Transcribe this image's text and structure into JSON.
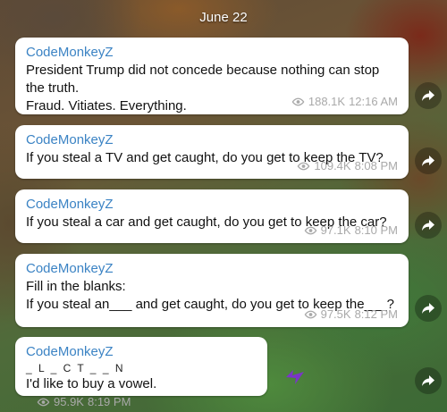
{
  "date_label": "June 22",
  "messages": [
    {
      "author": "CodeMonkeyZ",
      "lines": [
        "President Trump did not concede because nothing can stop the truth.",
        "Fraud. Vitiates. Everything."
      ],
      "views": "188.1K",
      "time": "12:16 AM"
    },
    {
      "author": "CodeMonkeyZ",
      "lines": [
        "If you steal a TV and get caught, do you get to keep the TV?"
      ],
      "views": "109.4K",
      "time": "8:08 PM"
    },
    {
      "author": "CodeMonkeyZ",
      "lines": [
        "If you steal a car and get caught, do you get to keep the car?"
      ],
      "views": "97.1K",
      "time": "8:10 PM"
    },
    {
      "author": "CodeMonkeyZ",
      "lines": [
        "Fill in the blanks:",
        "If you steal an___ and get caught, do you get to keep the___?"
      ],
      "views": "97.5K",
      "time": "8:12 PM"
    },
    {
      "author": "CodeMonkeyZ",
      "lines": [
        "_ L _ C T _ _ N",
        "I'd like to buy a vowel."
      ],
      "views": "95.9K",
      "time": "8:19 PM"
    }
  ],
  "icons": {
    "views": "eye-icon",
    "share": "share-arrow-icon"
  },
  "colors": {
    "author": "#3b83c4",
    "meta": "#a9a9a9",
    "bubble": "#ffffff"
  }
}
